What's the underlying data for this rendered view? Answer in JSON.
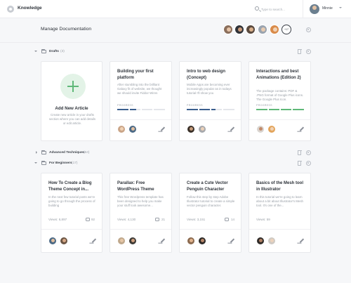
{
  "app": {
    "title": "Knowledge",
    "logo_icon": "logo-icon"
  },
  "search": {
    "placeholder": "Type to search..."
  },
  "user": {
    "name": "Minnie"
  },
  "page": {
    "title": "Manage Documentation",
    "team_more": "+17"
  },
  "sections": [
    {
      "name": "Drafts",
      "count": "(3)",
      "expanded": true
    },
    {
      "name": "Advanced Techniques",
      "count": "(64)",
      "expanded": false
    },
    {
      "name": "For Beginners",
      "count": "(17)",
      "expanded": true
    }
  ],
  "new_article": {
    "title": "Add New Article",
    "description": "Create new article in your drafts section where you can add details or edit article."
  },
  "drafts": [
    {
      "title": "Building your first platform",
      "description": "After stumbling into the brilliant Galaxy fit of website, we thought we should invite Fiddor Wires",
      "progress_label": "PROGRESS",
      "progress": 0.4,
      "progress_color": "#3b5f8e"
    },
    {
      "title": "Intro to web design (Concept)",
      "description": "Mobile Apps are becoming ever increasingly popular as in todays tutorial I'll show you",
      "progress_label": "PROGRESS",
      "progress": 0.6,
      "progress_color": "#3b5f8e"
    },
    {
      "title": "Interactions and best Animations (Edition 2)",
      "description": "The package contains: PDF & .PNG format of Google Plus icons. The Google Plus Icon.",
      "progress_label": "PROGRESS",
      "progress": 1.0,
      "progress_color": "#5fb878"
    }
  ],
  "beginners": [
    {
      "title": "How To Create a Blog Theme Concept in...",
      "description": "In the next few tutorial posts we're going to go through the process of building",
      "views": "Views: 6,897",
      "comments": "92"
    },
    {
      "title": "Parallax: Free WordPress Theme",
      "description": "This free Wordpress template has been designed to help you make your stuff look awesome...",
      "views": "Views: 4,130",
      "comments": "21"
    },
    {
      "title": "Create a Cute Vector Penguin Character",
      "description": "Follow this step by step Adobe Illustrator tutorial to create a simple vector penguin character.",
      "views": "Views: 3,151",
      "comments": "14"
    },
    {
      "title": "Basics of the Mesh tool in Illustrator",
      "description": "In this tutorial we're going to learn about a bit about Illustrator's Mesh tool. It's one of the...",
      "views": "Views: 59",
      "comments": ""
    }
  ],
  "colors": {
    "accent_green": "#5fb878",
    "accent_blue": "#3b5f8e"
  }
}
